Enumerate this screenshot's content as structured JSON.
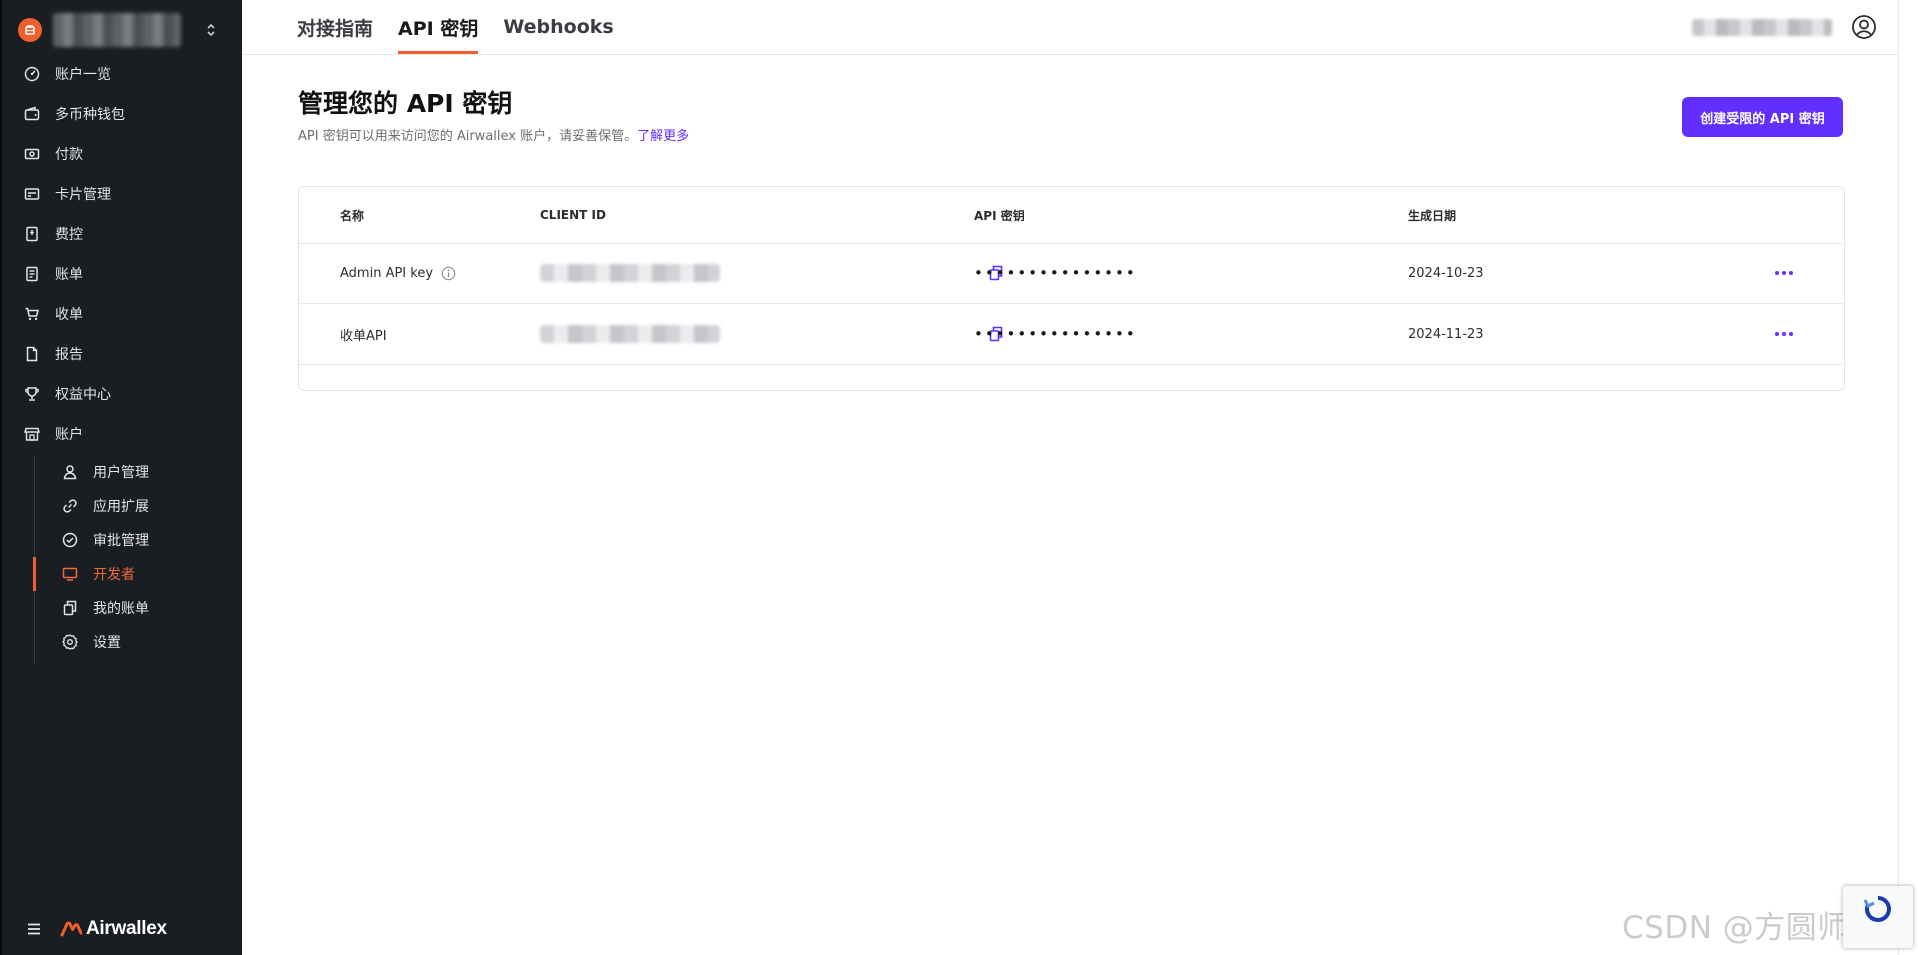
{
  "sidebar": {
    "items": [
      {
        "label": "账户一览",
        "icon": "dashboard-icon"
      },
      {
        "label": "多币种钱包",
        "icon": "wallet-icon"
      },
      {
        "label": "付款",
        "icon": "payment-icon"
      },
      {
        "label": "卡片管理",
        "icon": "card-icon"
      },
      {
        "label": "费控",
        "icon": "expense-icon"
      },
      {
        "label": "账单",
        "icon": "bill-icon"
      },
      {
        "label": "收单",
        "icon": "cart-icon"
      },
      {
        "label": "报告",
        "icon": "report-icon"
      },
      {
        "label": "权益中心",
        "icon": "trophy-icon"
      },
      {
        "label": "账户",
        "icon": "store-icon"
      }
    ],
    "sub_items": [
      {
        "label": "用户管理",
        "icon": "user-icon"
      },
      {
        "label": "应用扩展",
        "icon": "link-icon"
      },
      {
        "label": "审批管理",
        "icon": "check-circle-icon"
      },
      {
        "label": "开发者",
        "icon": "monitor-icon",
        "active": true
      },
      {
        "label": "我的账单",
        "icon": "copy-icon"
      },
      {
        "label": "设置",
        "icon": "gear-icon"
      }
    ],
    "logo_text": "Airwallex"
  },
  "tabs": [
    {
      "label": "对接指南",
      "active": false
    },
    {
      "label": "API 密钥",
      "active": true
    },
    {
      "label": "Webhooks",
      "active": false
    }
  ],
  "main": {
    "title": "管理您的 API 密钥",
    "description": "API 密钥可以用来访问您的 Airwallex 账户，请妥善保管。",
    "learn_more": "了解更多",
    "create_button": "创建受限的 API 密钥"
  },
  "table": {
    "headers": {
      "name": "名称",
      "client_id": "CLIENT ID",
      "api_key": "API 密钥",
      "created": "生成日期"
    },
    "rows": [
      {
        "name": "Admin API key",
        "api_key": "•••••••••••••••",
        "created": "2024-10-23"
      },
      {
        "name": "收单API",
        "api_key": "•••••••••••••••",
        "created": "2024-11-23"
      }
    ]
  },
  "watermark": "CSDN @方圆师兄",
  "colors": {
    "accent": "#612fff",
    "brand": "#ef5f2e",
    "sidebar_bg": "#1a1d21"
  }
}
